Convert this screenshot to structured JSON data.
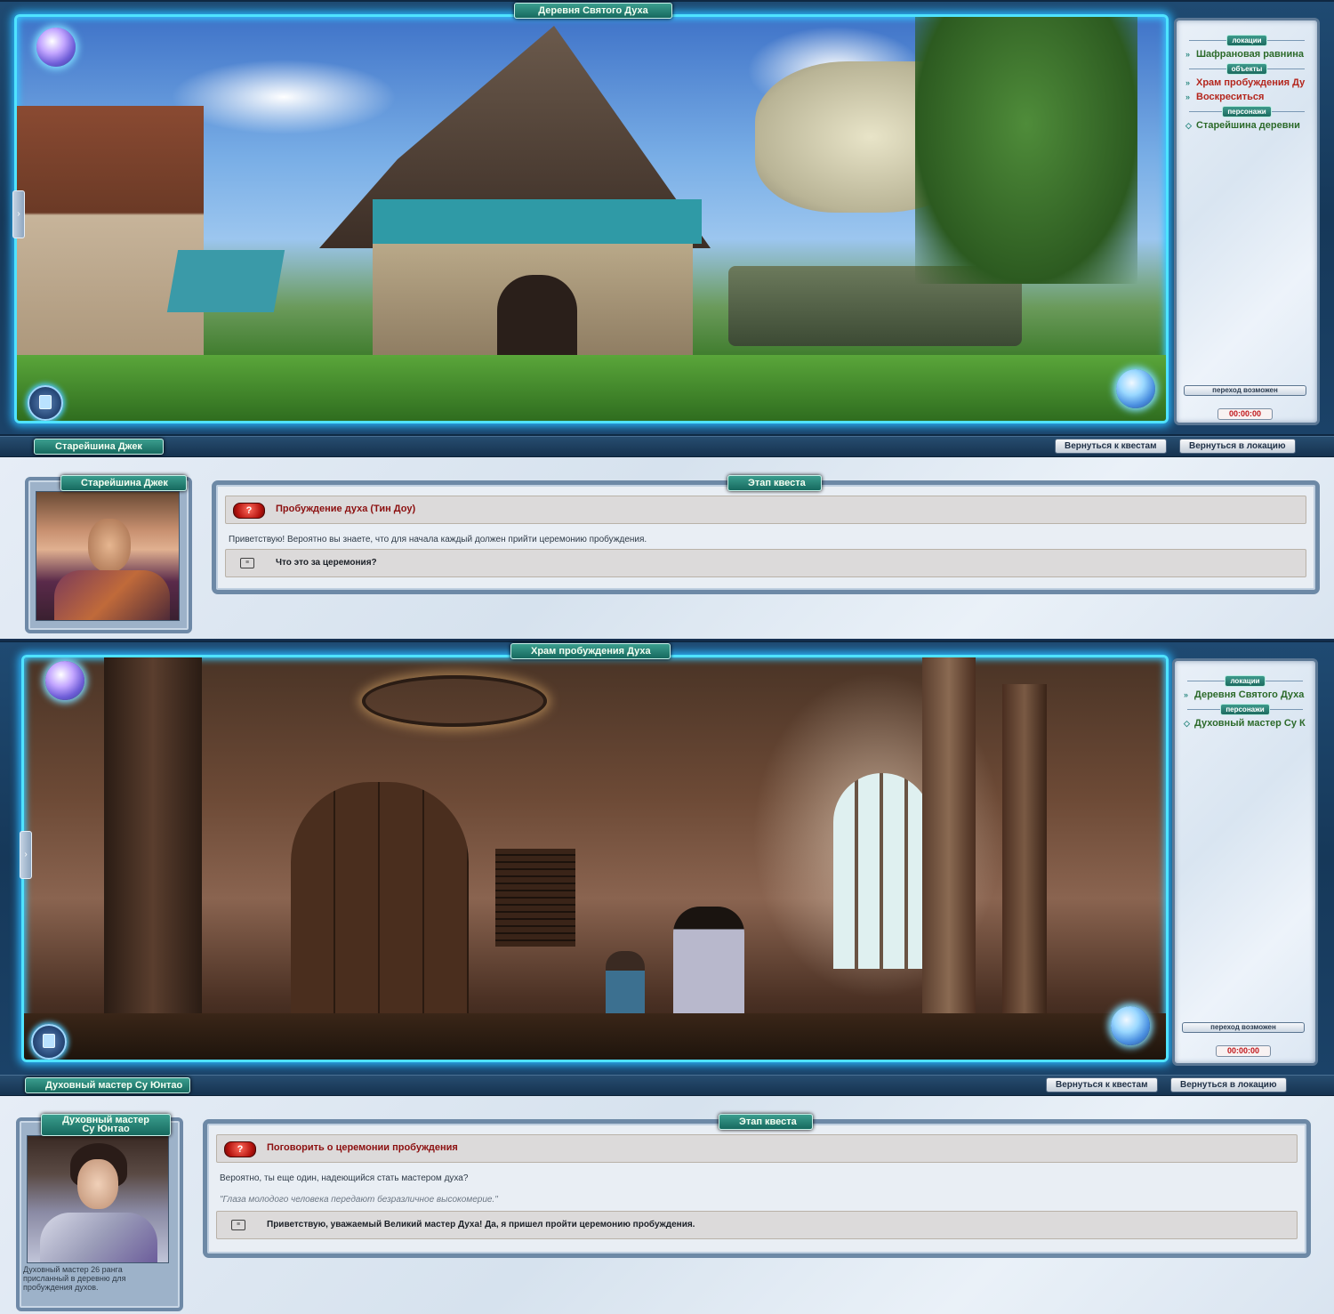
{
  "screen1": {
    "location_title": "Деревня Святого Духа",
    "side": {
      "locations_label": "локации",
      "locations": [
        "Шафрановая равнина"
      ],
      "objects_label": "объекты",
      "objects": [
        "Храм пробуждения Ду",
        "Воскреситься"
      ],
      "characters_label": "персонажи",
      "characters": [
        "Старейшина деревни"
      ],
      "transition_label": "переход возможен",
      "timer": "00:00:00"
    }
  },
  "dialog1": {
    "npc_name_bar": "Старейшина Джек",
    "back_to_quests": "Вернуться к квестам",
    "back_to_location": "Вернуться в локацию",
    "portrait_name": "Старейшина Джек",
    "stage_label": "Этап квеста",
    "quest_title": "Пробуждение духа (Тин Доу)",
    "quest_text": "Приветствую! Вероятно вы знаете, что для начала каждый должен прийти церемонию пробуждения.",
    "answer": "Что это за церемония?"
  },
  "screen2": {
    "location_title": "Храм пробуждения Духа",
    "side": {
      "locations_label": "локации",
      "locations": [
        "Деревня Святого Духа"
      ],
      "characters_label": "персонажи",
      "characters": [
        "Духовный мастер Су К"
      ],
      "transition_label": "переход возможен",
      "timer": "00:00:00"
    }
  },
  "dialog2": {
    "npc_name_bar": "Духовный мастер Су Юнтао",
    "back_to_quests": "Вернуться к квестам",
    "back_to_location": "Вернуться в локацию",
    "portrait_name_line1": "Духовный мастер",
    "portrait_name_line2": "Су Юнтао",
    "npc_description": "Духовный мастер 26 ранга присланный в деревню для пробуждения духов.",
    "stage_label": "Этап квеста",
    "quest_title": "Поговорить о церемонии пробуждения",
    "quest_text": "Вероятно, ты еще один, надеющийся стать мастером духа?",
    "quest_note": "\"Глаза молодого человека передают безразличное высокомерие.\"",
    "answer": "Приветствую, уважаемый Великий мастер Духа! Да, я пришел пройти церемонию пробуждения."
  },
  "icons": {
    "question": "question-mark-icon",
    "answer": "speech-bubble-icon",
    "bullet": "diamond-bullet-icon",
    "orb": "crystal-orb-icon",
    "map": "map-button-icon"
  },
  "colors": {
    "frame_glow": "#4fe3ff",
    "title_plate": "#1d6b60",
    "quest_title": "#8c1010",
    "objects_link": "#b4261d",
    "locations_link": "#2c6a2a",
    "timer": "#c0161a"
  }
}
